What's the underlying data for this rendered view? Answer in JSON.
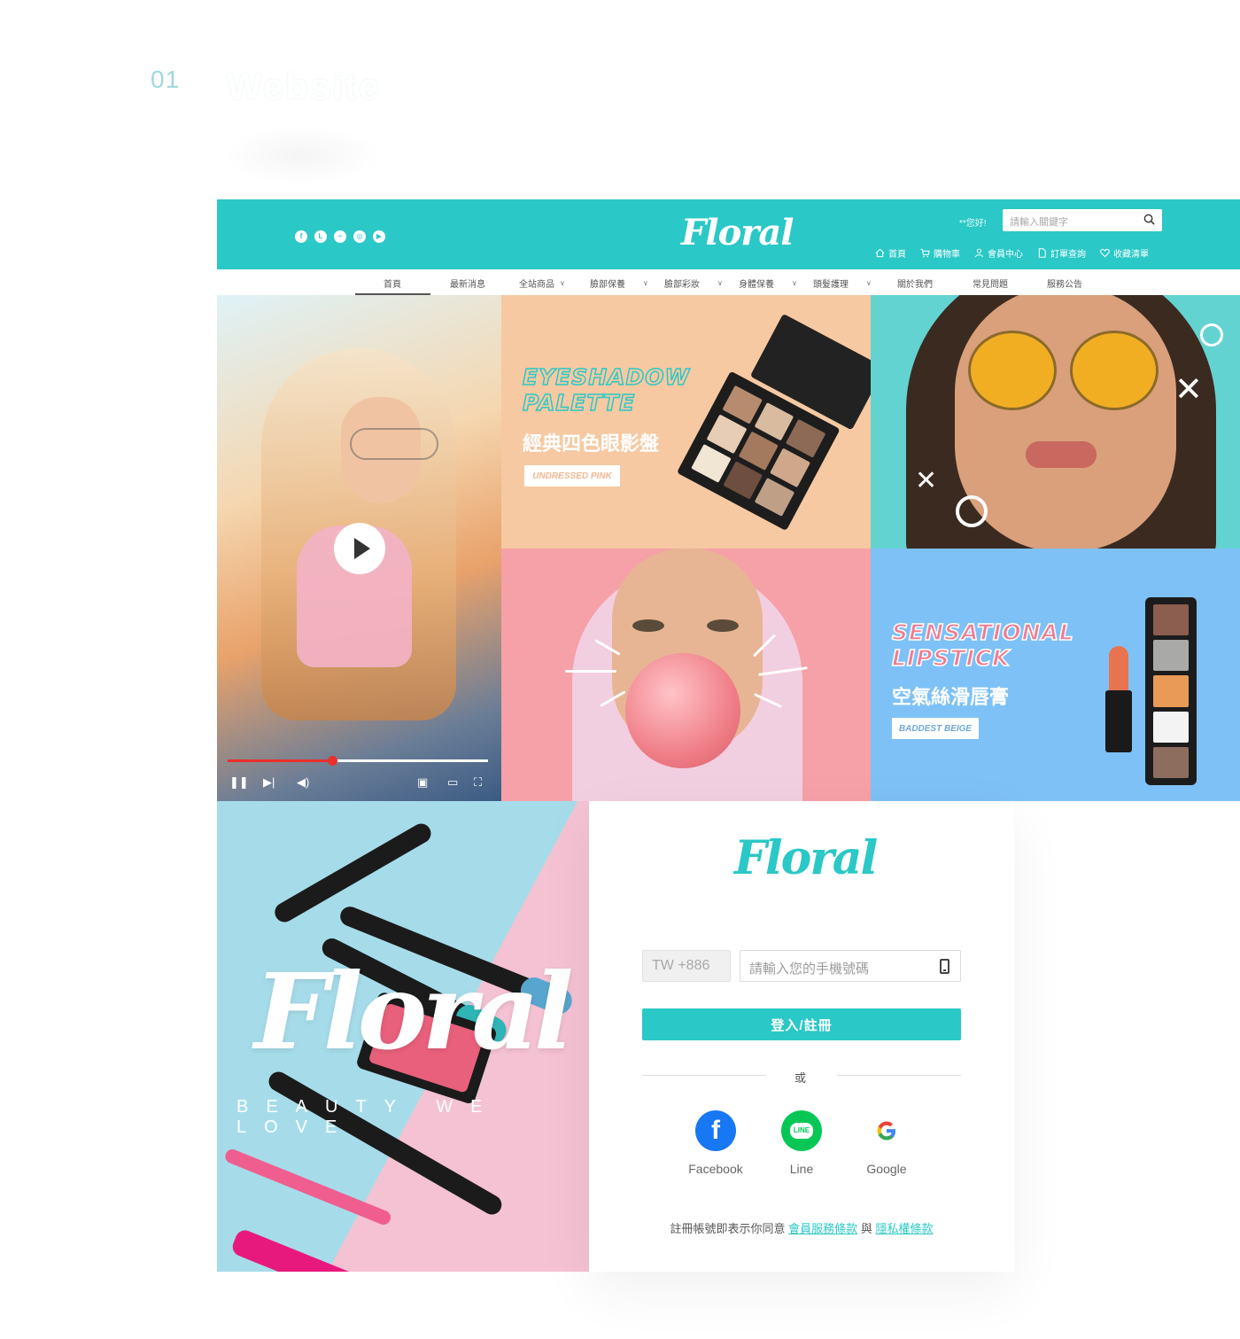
{
  "section": {
    "number": "01",
    "title": "Website"
  },
  "header": {
    "greeting": "**您好!",
    "search_placeholder": "請輸入關鍵字",
    "logo": "Floral",
    "social_icons": [
      "facebook-icon",
      "line-icon",
      "messenger-icon",
      "instagram-icon",
      "youtube-icon"
    ],
    "links": [
      {
        "label": "首頁",
        "icon": "home-icon"
      },
      {
        "label": "購物車",
        "icon": "cart-icon"
      },
      {
        "label": "會員中心",
        "icon": "user-icon"
      },
      {
        "label": "訂單查詢",
        "icon": "document-icon"
      },
      {
        "label": "收藏清單",
        "icon": "heart-icon"
      }
    ]
  },
  "nav": {
    "items": [
      {
        "label": "首頁"
      },
      {
        "label": "最新消息"
      },
      {
        "label": "全站商品",
        "dropdown": true
      },
      {
        "label": "臉部保養",
        "dropdown": true
      },
      {
        "label": "臉部彩妝",
        "dropdown": true
      },
      {
        "label": "身體保養",
        "dropdown": true
      },
      {
        "label": "頭髮護理",
        "dropdown": true
      },
      {
        "label": "關於我們"
      },
      {
        "label": "常見問題"
      },
      {
        "label": "服務公告"
      }
    ]
  },
  "banners": {
    "eyeshadow": {
      "title_line1": "EYESHADOW",
      "title_line2": "PALETTE",
      "subtitle": "經典四色眼影盤",
      "tag": "UNDRESSED PINK"
    },
    "lipstick": {
      "title_line1": "SENSATIONAL",
      "title_line2": "LIPSTICK",
      "subtitle": "空氣絲滑唇膏",
      "tag": "BADDEST BEIGE"
    },
    "video": {
      "progress": 0.4
    }
  },
  "hero": {
    "logo": "Floral",
    "tagline": "BEAUTY WE LOVE"
  },
  "login": {
    "logo": "Floral",
    "country_code": "TW +886",
    "phone_placeholder": "請輸入您的手機號碼",
    "submit_label": "登入/註冊",
    "or_label": "或",
    "providers": [
      {
        "label": "Facebook",
        "color": "#1877f2"
      },
      {
        "label": "Line",
        "color": "#06c755"
      },
      {
        "label": "Google",
        "color": "#ffffff"
      }
    ],
    "terms_prefix": "註冊帳號即表示你同意",
    "terms_link1": "會員服務條款",
    "terms_mid": "與",
    "terms_link2": "隱私權條款"
  },
  "colors": {
    "brand": "#2ac8c6",
    "accent_red": "#e9302c"
  }
}
